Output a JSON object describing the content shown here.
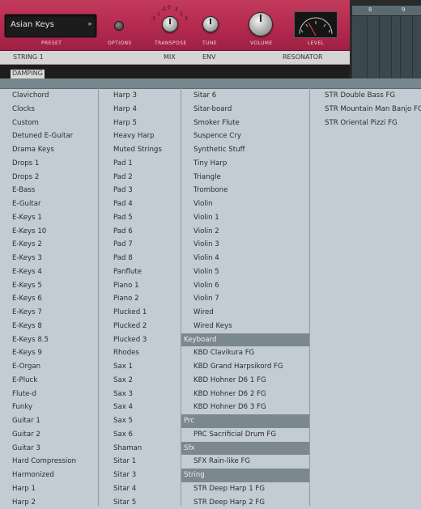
{
  "synth": {
    "preset_name": "Asian Keys",
    "labels": {
      "preset": "PRESET",
      "options": "OPTIONS",
      "transpose": "TRANSPOSE",
      "tune": "TUNE",
      "volume": "VOLUME",
      "level": "LEVEL"
    },
    "transpose_scale": {
      "minus2": "-2",
      "minus1": "-1",
      "zero": "0",
      "plus1": "1",
      "plus2": "2",
      "minus3": "-3",
      "plus3": "3"
    },
    "tabs": [
      "STRING 1",
      "MIX",
      "ENV",
      "RESONATOR"
    ],
    "damping_label": "DAMPING",
    "ruler": [
      "8",
      "9"
    ],
    "colors": {
      "panel": "#b42a4f",
      "list_bg": "#c3ccd2",
      "category_header": "#7c888f"
    }
  },
  "preset_list": {
    "columns": [
      [
        "Clavichord",
        "Clocks",
        "Custom",
        "Detuned E-Guitar",
        "Drama Keys",
        "Drops 1",
        "Drops 2",
        "E-Bass",
        "E-Guitar",
        "E-Keys 1",
        "E-Keys 10",
        "E-Keys 2",
        "E-Keys 3",
        "E-Keys 4",
        "E-Keys 5",
        "E-Keys 6",
        "E-Keys 7",
        "E-Keys 8",
        "E-Keys 8.5",
        "E-Keys 9",
        "E-Organ",
        "E-Pluck",
        "Flute-d",
        "Funky",
        "Guitar 1",
        "Guitar 2",
        "Guitar 3",
        "Hard Compression",
        "Harmonized",
        "Harp 1",
        "Harp 2"
      ],
      [
        "Harp 3",
        "Harp 4",
        "Harp 5",
        "Heavy Harp",
        "Muted Strings",
        "Pad 1",
        "Pad 2",
        "Pad 3",
        "Pad 4",
        "Pad 5",
        "Pad 6",
        "Pad 7",
        "Pad 8",
        "Panflute",
        "Piano 1",
        "Piano 2",
        "Plucked 1",
        "Plucked 2",
        "Plucked 3",
        "Rhodes",
        "Sax 1",
        "Sax 2",
        "Sax 3",
        "Sax 4",
        "Sax 5",
        "Sax 6",
        "Shaman",
        "Sitar 1",
        "Sitar 3",
        "Sitar 4",
        "Sitar 5"
      ],
      [
        "Sitar 6",
        "Sitar-board",
        "Smoker Flute",
        "Suspence Cry",
        "Synthetic Stuff",
        "Tiny Harp",
        "Triangle",
        "Trombone",
        "Violin",
        "Violin 1",
        "Violin 2",
        "Violin 3",
        "Violin 4",
        "Violin 5",
        "Violin 6",
        "Violin 7",
        "Wired",
        "Wired Keys"
      ],
      [
        "STR Double Bass FG",
        "STR Mountain Man Banjo FG",
        "STR Oriental Pizzi FG"
      ]
    ],
    "sections": [
      {
        "header": "Keyboard",
        "items": [
          "KBD Clavikura FG",
          "KBD Grand Harpsikord FG",
          "KBD Hohner D6 1 FG",
          "KBD Hohner D6 2 FG",
          "KBD Hohner D6 3 FG"
        ]
      },
      {
        "header": "Prc",
        "items": [
          "PRC Sacrificial Drum FG"
        ]
      },
      {
        "header": "Sfx",
        "items": [
          "SFX Rain-like FG"
        ]
      },
      {
        "header": "String",
        "items": [
          "STR Deep Harp 1 FG",
          "STR Deep Harp 2 FG"
        ]
      }
    ]
  }
}
